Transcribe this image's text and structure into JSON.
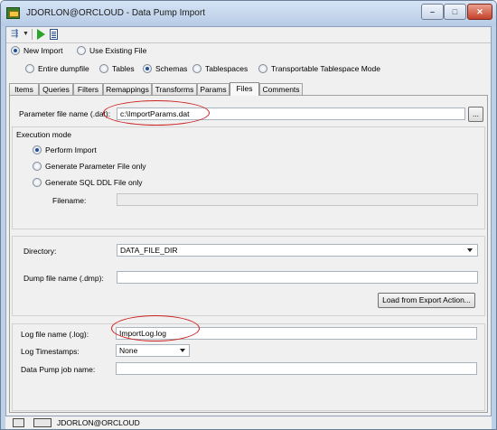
{
  "window": {
    "title": "JDORLON@ORCLOUD - Data Pump Import",
    "min_glyph": "–",
    "max_glyph": "□",
    "close_glyph": "✕"
  },
  "toolbar": {
    "arrow_glyph": "⇶",
    "dropdown_glyph": "▼"
  },
  "import_mode": {
    "options": [
      "New Import",
      "Use Existing File"
    ],
    "selected": "New Import"
  },
  "import_scope": {
    "options": [
      "Entire dumpfile",
      "Tables",
      "Schemas",
      "Tablespaces",
      "Transportable Tablespace Mode"
    ],
    "selected": "Schemas"
  },
  "tabs": {
    "items": [
      "Items",
      "Queries",
      "Filters",
      "Remappings",
      "Transforms",
      "Params",
      "Files",
      "Comments"
    ],
    "active": "Files"
  },
  "files": {
    "param_file_label": "Parameter file name (.dat):",
    "param_file_value": "c:\\ImportParams.dat",
    "browse_label": "...",
    "execution_mode": {
      "title": "Execution mode",
      "options": [
        "Perform Import",
        "Generate Parameter File only",
        "Generate SQL DDL File only"
      ],
      "selected": "Perform Import",
      "filename_label": "Filename:",
      "filename_value": ""
    },
    "directory_label": "Directory:",
    "directory_value": "DATA_FILE_DIR",
    "dump_file_label": "Dump file name (.dmp):",
    "dump_file_value": "",
    "load_button": "Load from Export Action...",
    "log_file_label": "Log file name (.log):",
    "log_file_value": "ImportLog.log",
    "log_timestamps_label": "Log Timestamps:",
    "log_timestamps_value": "None",
    "job_name_label": "Data Pump job name:",
    "job_name_value": ""
  },
  "status": {
    "connection": "JDORLON@ORCLOUD"
  },
  "colors": {
    "annotation_oval": "#cc1f1f",
    "run_icon": "#2aa52a"
  }
}
